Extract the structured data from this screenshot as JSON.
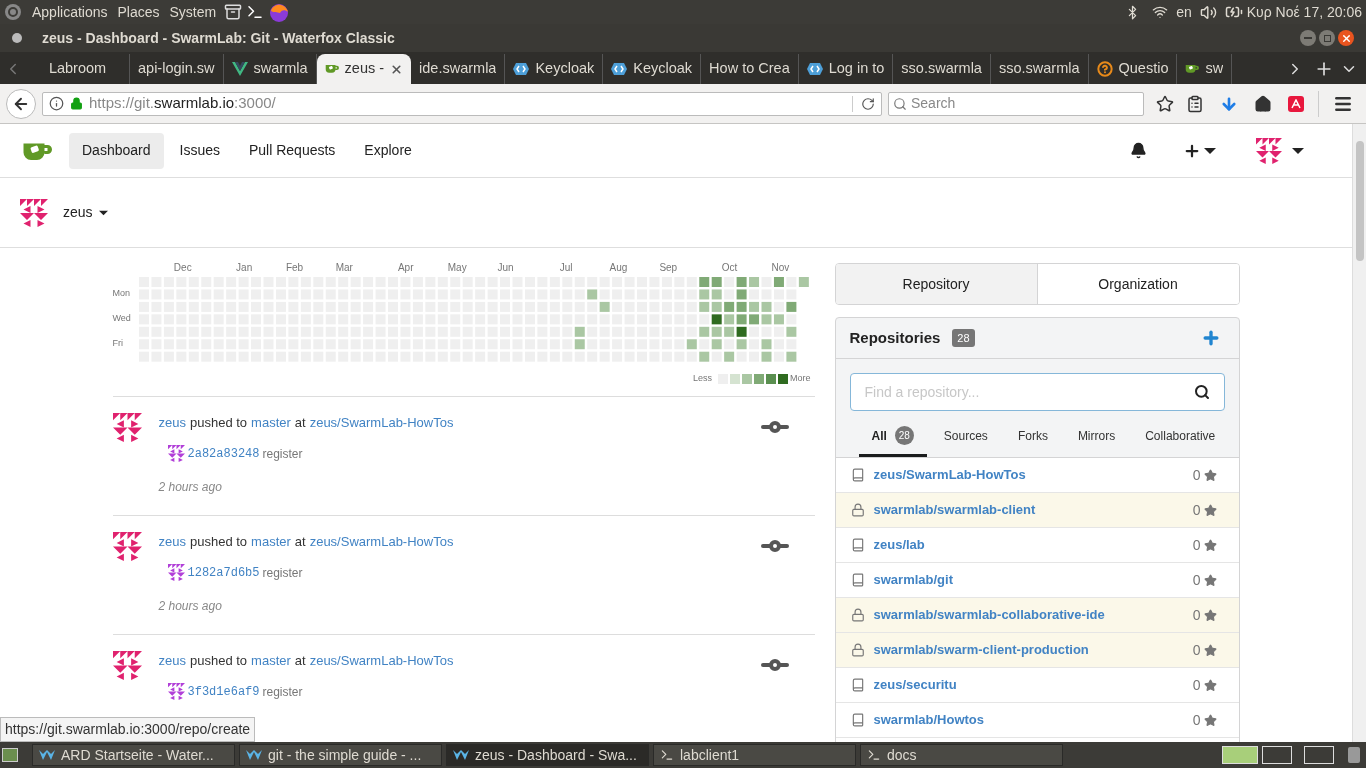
{
  "top_panel": {
    "menus": [
      "Applications",
      "Places",
      "System"
    ],
    "keyboard_layout": "en",
    "clock": "Κυρ Νοέ 17, 20:06"
  },
  "window": {
    "title": "zeus - Dashboard - SwarmLab: Git - Waterfox Classic"
  },
  "browser_tabs": [
    {
      "label": "Labroom",
      "kind": "plain",
      "selected": false
    },
    {
      "label": "api-login.sw",
      "kind": "plain",
      "selected": false
    },
    {
      "label": "swarmla",
      "kind": "vue",
      "selected": false
    },
    {
      "label": "zeus - ",
      "kind": "gitea",
      "selected": true
    },
    {
      "label": "ide.swarmla",
      "kind": "plain",
      "selected": false
    },
    {
      "label": "Keycloak",
      "kind": "keycloak",
      "selected": false
    },
    {
      "label": "Keycloak",
      "kind": "keycloak",
      "selected": false
    },
    {
      "label": "How to Crea",
      "kind": "plain",
      "selected": false
    },
    {
      "label": "Log in to",
      "kind": "keycloak",
      "selected": false
    },
    {
      "label": "sso.swarmla",
      "kind": "plain",
      "selected": false
    },
    {
      "label": "sso.swarmla",
      "kind": "plain",
      "selected": false
    },
    {
      "label": "Questio",
      "kind": "question",
      "selected": false
    },
    {
      "label": "sw",
      "kind": "gitea",
      "selected": false
    }
  ],
  "address_bar": {
    "scheme": "https://git.",
    "domain": "swarmlab.io",
    "rest": ":3000/"
  },
  "search_field": {
    "placeholder": "Search"
  },
  "site_nav": [
    {
      "label": "Dashboard",
      "selected": true
    },
    {
      "label": "Issues",
      "selected": false
    },
    {
      "label": "Pull Requests",
      "selected": false
    },
    {
      "label": "Explore",
      "selected": false
    }
  ],
  "context_user": "zeus",
  "heatmap": {
    "months": [
      "Dec",
      "Jan",
      "Feb",
      "Mar",
      "Apr",
      "May",
      "Jun",
      "Jul",
      "Aug",
      "Sep",
      "Oct",
      "Nov"
    ],
    "days": [
      "Mon",
      "Wed",
      "Fri"
    ],
    "less": "Less",
    "more": "More"
  },
  "feed": [
    {
      "user": "zeus",
      "action": "pushed to",
      "branch": "master",
      "at": "at",
      "repo": "zeus/SwarmLab-HowTos",
      "commit": "2a82a83248",
      "message": "register",
      "time": "2 hours ago"
    },
    {
      "user": "zeus",
      "action": "pushed to",
      "branch": "master",
      "at": "at",
      "repo": "zeus/SwarmLab-HowTos",
      "commit": "1282a7d6b5",
      "message": "register",
      "time": "2 hours ago"
    },
    {
      "user": "zeus",
      "action": "pushed to",
      "branch": "master",
      "at": "at",
      "repo": "zeus/SwarmLab-HowTos",
      "commit": "3f3d1e6af9",
      "message": "register"
    }
  ],
  "switcher": [
    {
      "label": "Repository",
      "selected": true
    },
    {
      "label": "Organization",
      "selected": false
    }
  ],
  "repositories": {
    "title": "Repositories",
    "count": "28",
    "placeholder": "Find a repository...",
    "filters": [
      {
        "label": "All",
        "count": "28",
        "selected": true
      },
      {
        "label": "Sources",
        "selected": false
      },
      {
        "label": "Forks",
        "selected": false
      },
      {
        "label": "Mirrors",
        "selected": false
      },
      {
        "label": "Collaborative",
        "selected": false
      }
    ],
    "items": [
      {
        "name": "zeus/SwarmLab-HowTos",
        "private": false,
        "stars": "0"
      },
      {
        "name": "swarmlab/swarmlab-client",
        "private": true,
        "stars": "0"
      },
      {
        "name": "zeus/lab",
        "private": false,
        "stars": "0"
      },
      {
        "name": "swarmlab/git",
        "private": false,
        "stars": "0"
      },
      {
        "name": "swarmlab/swarmlab-collaborative-ide",
        "private": true,
        "stars": "0"
      },
      {
        "name": "swarmlab/swarm-client-production",
        "private": true,
        "stars": "0"
      },
      {
        "name": "zeus/securitu",
        "private": false,
        "stars": "0"
      },
      {
        "name": "swarmlab/Howtos",
        "private": false,
        "stars": "0"
      }
    ]
  },
  "status_link": "https://git.swarmlab.io:3000/repo/create",
  "taskbar": [
    {
      "label": "ARD Startseite - Water...",
      "kind": "browser",
      "selected": false
    },
    {
      "label": "git - the simple guide - ...",
      "kind": "browser",
      "selected": false
    },
    {
      "label": "zeus - Dashboard - Swa...",
      "kind": "browser",
      "selected": true
    },
    {
      "label": "labclient1",
      "kind": "terminal",
      "selected": false
    },
    {
      "label": "docs",
      "kind": "terminal",
      "selected": false
    }
  ]
}
